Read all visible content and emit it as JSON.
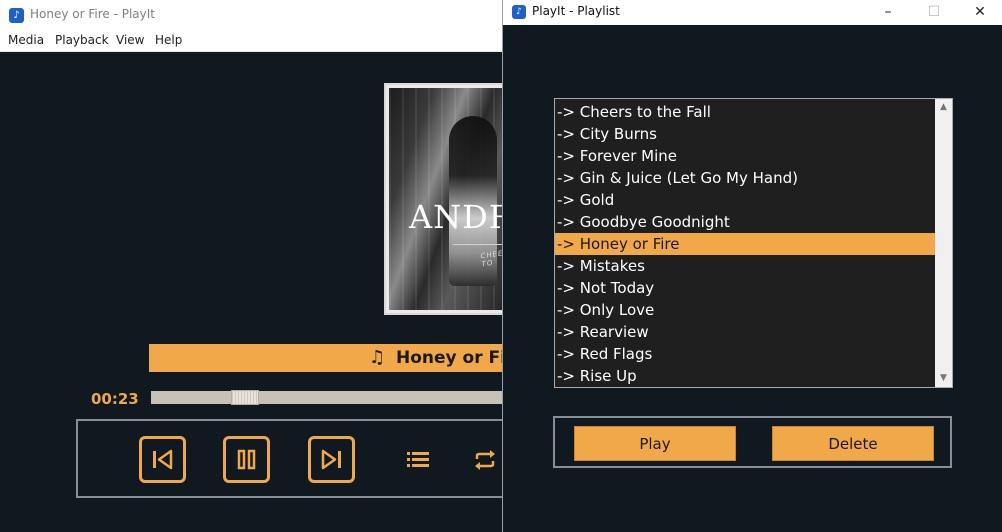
{
  "main_window": {
    "title": "Honey or Fire - PlayIt",
    "app_icon": "music-note-icon",
    "menu": [
      "Media",
      "Playback",
      "View",
      "Help"
    ],
    "album_art": {
      "artist_text": "ANDR",
      "subtitle": "CHEERS TO"
    },
    "now_playing": {
      "icon": "music-note-icon",
      "title": "Honey or Fire"
    },
    "elapsed_time": "00:23",
    "seek_progress": 0.24,
    "controls": [
      "previous-icon",
      "pause-icon",
      "next-icon",
      "playlist-icon",
      "repeat-icon"
    ],
    "accent_color": "#f0a848"
  },
  "playlist_window": {
    "title": "PlayIt - Playlist",
    "window_controls": {
      "minimize": "–",
      "maximize": "☐",
      "close": "✕"
    },
    "items": [
      "-> Cheers to the Fall",
      "-> City Burns",
      "-> Forever Mine",
      "-> Gin & Juice (Let Go My Hand)",
      "-> Gold",
      "-> Goodbye Goodnight",
      "-> Honey or Fire",
      "-> Mistakes",
      "-> Not Today",
      "-> Only Love",
      "-> Rearview",
      "-> Red Flags",
      "-> Rise Up"
    ],
    "selected_index": 6,
    "buttons": {
      "play": "Play",
      "delete": "Delete"
    }
  }
}
